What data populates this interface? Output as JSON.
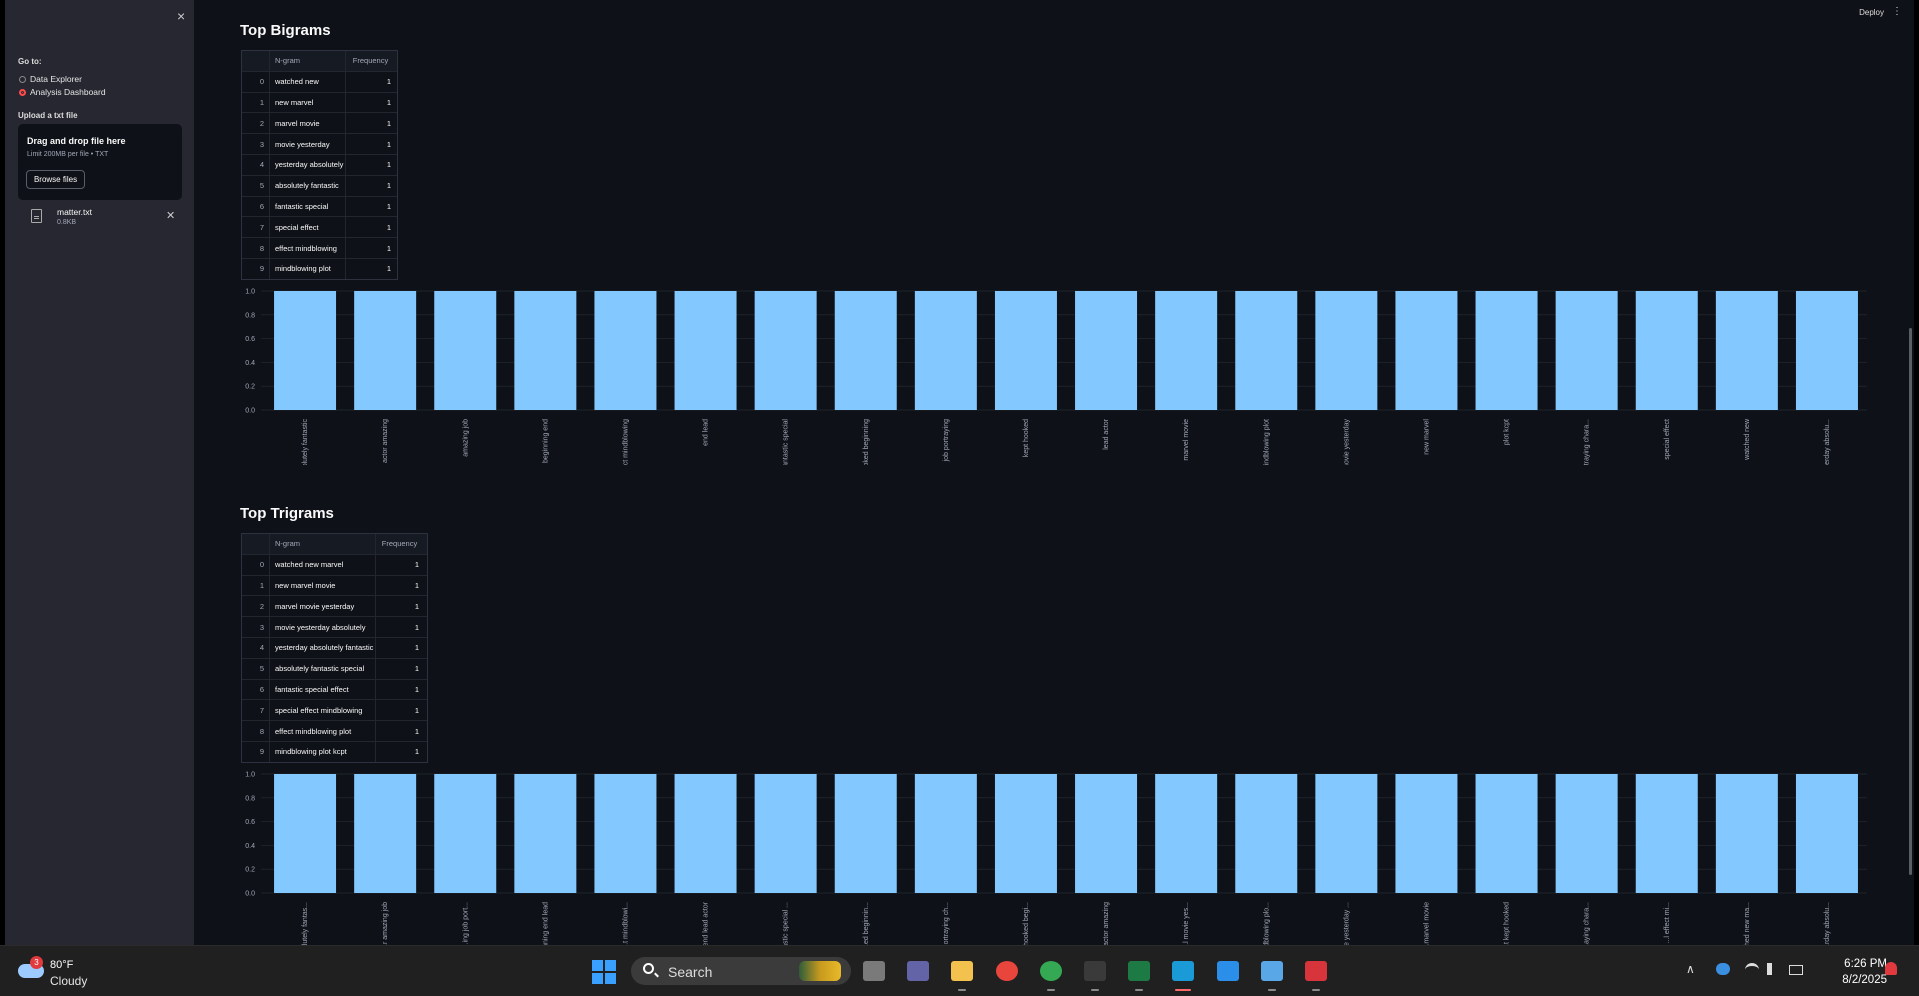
{
  "sidebar": {
    "close_glyph": "×",
    "goto_label": "Go to:",
    "nav_options": [
      "Data Explorer",
      "Analysis Dashboard"
    ],
    "selected_option": "Analysis Dashboard",
    "upload_label": "Upload a txt file",
    "dropzone_title": "Drag and drop file here",
    "dropzone_limit": "Limit 200MB per file • TXT",
    "browse_label": "Browse files",
    "file_name": "matter.txt",
    "file_size": "0.8KB"
  },
  "header": {
    "deploy_label": "Deploy",
    "menu_glyph": "⋮"
  },
  "bigrams": {
    "title": "Top Bigrams",
    "columns": [
      "",
      "N-gram",
      "Frequency"
    ],
    "rows": [
      [
        "0",
        "watched new",
        "1"
      ],
      [
        "1",
        "new marvel",
        "1"
      ],
      [
        "2",
        "marvel movie",
        "1"
      ],
      [
        "3",
        "movie yesterday",
        "1"
      ],
      [
        "4",
        "yesterday absolutely",
        "1"
      ],
      [
        "5",
        "absolutely fantastic",
        "1"
      ],
      [
        "6",
        "fantastic special",
        "1"
      ],
      [
        "7",
        "special effect",
        "1"
      ],
      [
        "8",
        "effect mindblowing",
        "1"
      ],
      [
        "9",
        "mindblowing plot",
        "1"
      ]
    ]
  },
  "trigrams": {
    "title": "Top Trigrams",
    "columns": [
      "",
      "N-gram",
      "Frequency"
    ],
    "rows": [
      [
        "0",
        "watched new marvel",
        "1"
      ],
      [
        "1",
        "new marvel movie",
        "1"
      ],
      [
        "2",
        "marvel movie yesterday",
        "1"
      ],
      [
        "3",
        "movie yesterday absolutely",
        "1"
      ],
      [
        "4",
        "yesterday absolutely fantastic",
        "1"
      ],
      [
        "5",
        "absolutely fantastic special",
        "1"
      ],
      [
        "6",
        "fantastic special effect",
        "1"
      ],
      [
        "7",
        "special effect mindblowing",
        "1"
      ],
      [
        "8",
        "effect mindblowing plot",
        "1"
      ],
      [
        "9",
        "mindblowing plot kcpt",
        "1"
      ]
    ]
  },
  "chart_data": [
    {
      "type": "bar",
      "categories": [
        "absolutely fantastic",
        "actor amazing",
        "amazing job",
        "beginning end",
        "effect mindblowing",
        "end lead",
        "fantastic special",
        "hooked beginning",
        "job portraying",
        "kept hooked",
        "lead actor",
        "marvel movie",
        "mindblowing plot",
        "movie yesterday",
        "new marvel",
        "plot kcpt",
        "portraying chara...",
        "special effect",
        "watched new",
        "yesterday absolu..."
      ],
      "values": [
        1,
        1,
        1,
        1,
        1,
        1,
        1,
        1,
        1,
        1,
        1,
        1,
        1,
        1,
        1,
        1,
        1,
        1,
        1,
        1
      ],
      "yticks": [
        "0.0",
        "0.2",
        "0.4",
        "0.6",
        "0.8",
        "1.0"
      ],
      "ylim": [
        0,
        1
      ],
      "bar_color": "#83c9ff",
      "grid": true
    },
    {
      "type": "bar",
      "categories": [
        "...lutely fantas...",
        "...r amazing job",
        "...ing job port...",
        "...nning end lead",
        "...t mindblowi...",
        "...end lead actor",
        "...astic special ...",
        "...ed beginnin...",
        "...ortraying ch...",
        "...hooked begi...",
        "...actor amazing",
        "...l movie yes...",
        "...dblowing plo...",
        "...e yesterday ...",
        "...marvel movie",
        "...t kept hooked",
        "...aying chara...",
        "...l effect mi...",
        "...hed new ma...",
        "...rday absolu..."
      ],
      "values": [
        1,
        1,
        1,
        1,
        1,
        1,
        1,
        1,
        1,
        1,
        1,
        1,
        1,
        1,
        1,
        1,
        1,
        1,
        1,
        1
      ],
      "yticks": [
        "0.0",
        "0.2",
        "0.4",
        "0.6",
        "0.8",
        "1.0"
      ],
      "ylim": [
        0,
        1
      ],
      "bar_color": "#83c9ff",
      "grid": true
    }
  ],
  "taskbar": {
    "weather_temp": "80°F",
    "weather_desc": "Cloudy",
    "weather_badge": "3",
    "search_placeholder": "Search",
    "time": "6:26 PM",
    "date": "8/2/2025",
    "apps": [
      "task-view-icon",
      "teams-icon",
      "file-explorer-icon",
      "chrome-icon",
      "chrome-profile-icon",
      "terminal-icon",
      "excel-icon",
      "edge-icon",
      "vscode-icon",
      "notepad-icon",
      "snipping-tool-icon"
    ]
  }
}
